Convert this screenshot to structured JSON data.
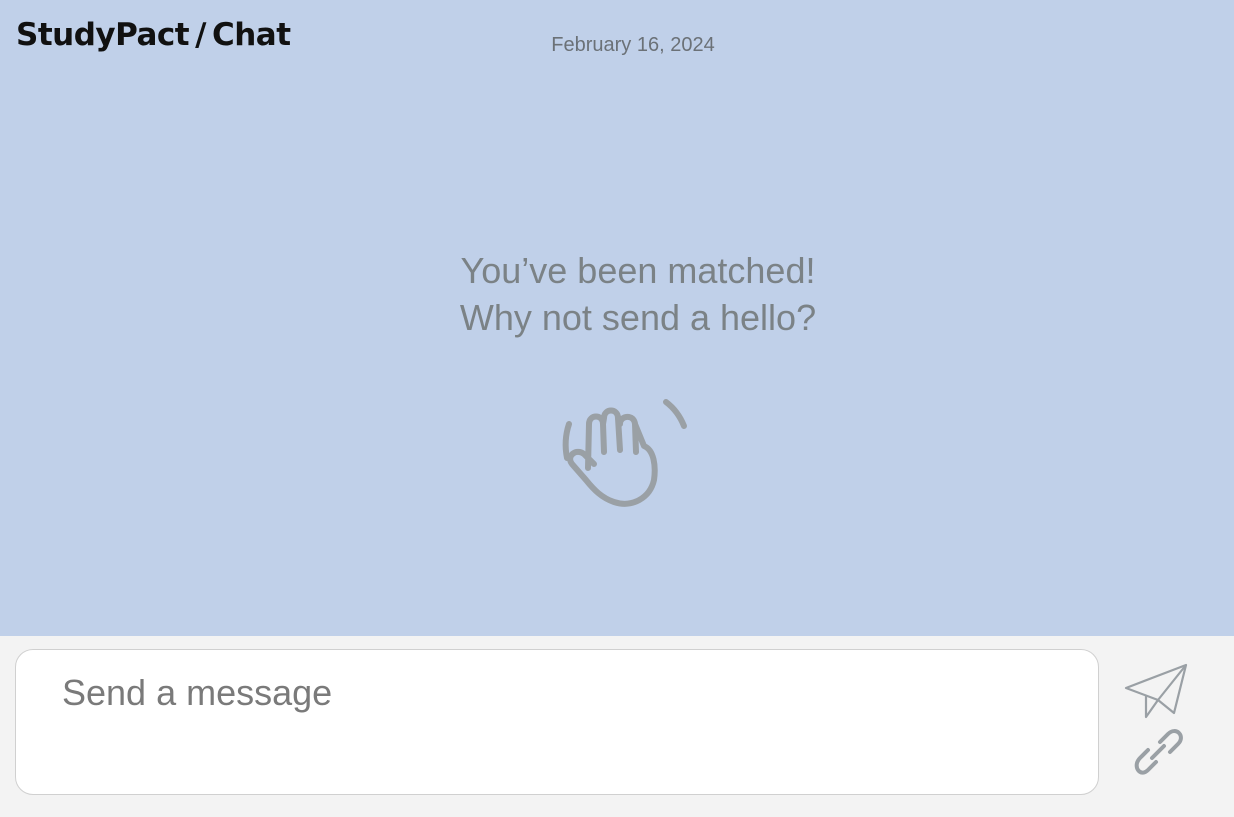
{
  "header": {
    "app_name": "StudyPact",
    "separator": "/",
    "section": "Chat"
  },
  "chat": {
    "date": "February 16, 2024",
    "empty_line_1": "You’ve been matched!",
    "empty_line_2": "Why not send a hello?",
    "empty_icon": "wave-hand-icon"
  },
  "composer": {
    "placeholder": "Send a message",
    "value": "",
    "send_icon": "paper-plane-icon",
    "attach_icon": "link-icon"
  },
  "colors": {
    "chat_background": "#c0d0e9",
    "composer_background": "#f3f3f3",
    "muted_text": "#7b8286",
    "icon_gray": "#9aa0a5"
  }
}
